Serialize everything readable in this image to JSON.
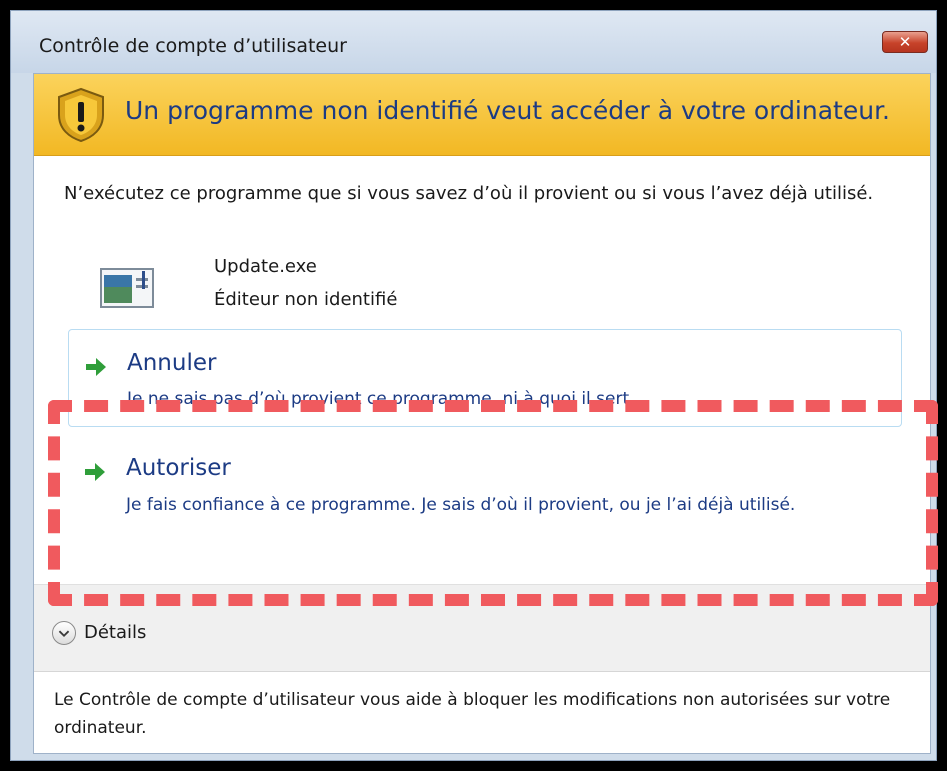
{
  "window": {
    "title": "Contrôle de compte d’utilisateur",
    "close_symbol": "✕"
  },
  "banner": {
    "text": "Un programme non identifié veut accéder à votre ordinateur.",
    "icon": "shield-warning-icon"
  },
  "intro": {
    "text": "N’exécutez ce programme que si vous savez d’où il provient ou si vous l’avez déjà utilisé."
  },
  "program": {
    "name": "Update.exe",
    "publisher": "Éditeur non identifié",
    "icon": "program-window-icon"
  },
  "options": {
    "cancel": {
      "title": "Annuler",
      "description": "Je ne sais pas d’où provient ce programme, ni à quoi il sert."
    },
    "allow": {
      "title": "Autoriser",
      "description": "Je fais confiance à ce programme. Je sais d’où il provient, ou je l’ai déjà utilisé."
    }
  },
  "details": {
    "label": "Détails"
  },
  "footer": {
    "text": "Le Contrôle de compte d’utilisateur vous aide à bloquer les modifications non autorisées sur votre ordinateur."
  },
  "colors": {
    "banner": "#f6c33a",
    "link_text": "#1c3b84",
    "arrow": "#2f9e3a",
    "highlight": "#f05a5e"
  }
}
